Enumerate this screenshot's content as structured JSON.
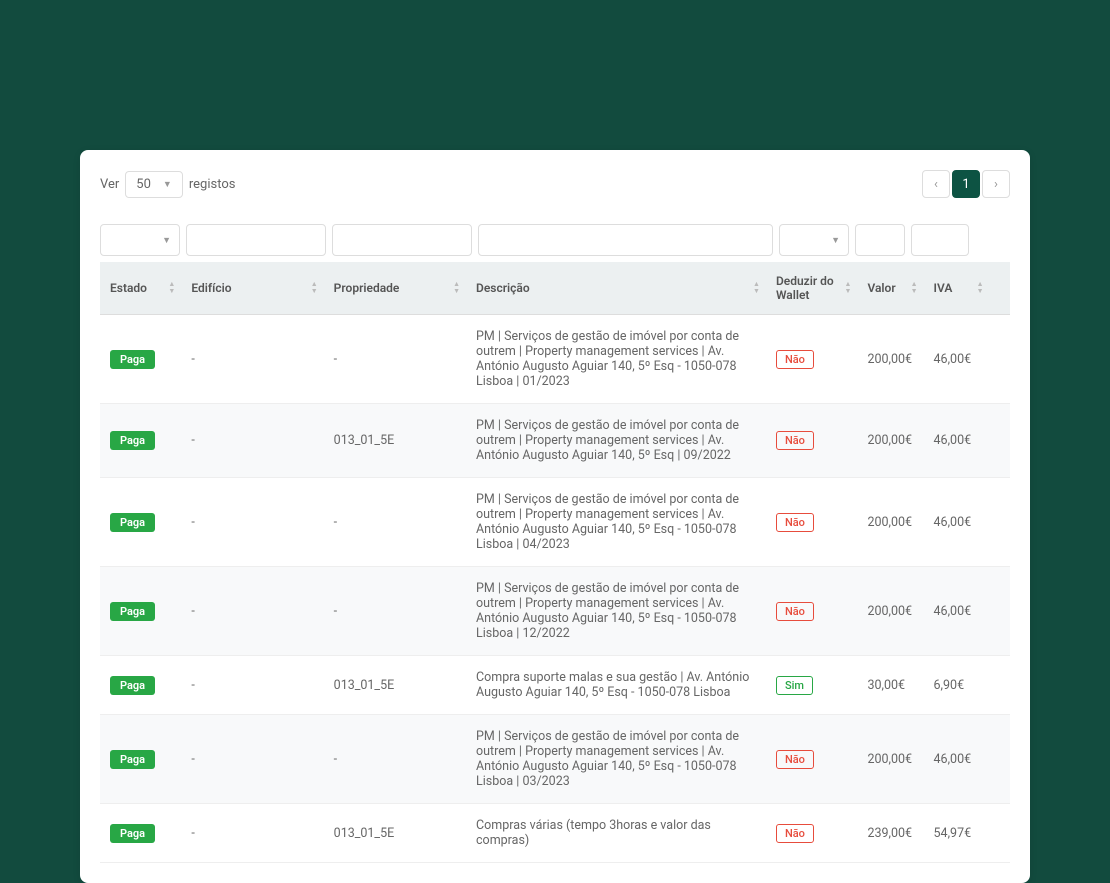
{
  "pageSize": {
    "prefix": "Ver",
    "value": "50",
    "suffix": "registos"
  },
  "pagination": {
    "current": "1"
  },
  "columns": {
    "estado": "Estado",
    "edificio": "Edifício",
    "propriedade": "Propriedade",
    "descricao": "Descrição",
    "deduzir": "Deduzir do Wallet",
    "valor": "Valor",
    "iva": "IVA"
  },
  "badges": {
    "paga": "Paga",
    "nao": "Não",
    "sim": "Sim"
  },
  "rows": [
    {
      "estado": "Paga",
      "edificio": "-",
      "propriedade": "-",
      "descricao": "PM | Serviços de gestão de imóvel por conta de outrem | Property management services | Av. António Augusto Aguiar 140, 5º Esq - 1050-078 Lisboa | 01/2023",
      "deduzir": "Não",
      "valor": "200,00€",
      "iva": "46,00€"
    },
    {
      "estado": "Paga",
      "edificio": "-",
      "propriedade": "013_01_5E",
      "descricao": "PM | Serviços de gestão de imóvel por conta de outrem | Property management services | Av. António Augusto Aguiar 140, 5º Esq | 09/2022",
      "deduzir": "Não",
      "valor": "200,00€",
      "iva": "46,00€"
    },
    {
      "estado": "Paga",
      "edificio": "-",
      "propriedade": "-",
      "descricao": "PM | Serviços de gestão de imóvel por conta de outrem | Property management services | Av. António Augusto Aguiar 140, 5º Esq - 1050-078 Lisboa | 04/2023",
      "deduzir": "Não",
      "valor": "200,00€",
      "iva": "46,00€"
    },
    {
      "estado": "Paga",
      "edificio": "-",
      "propriedade": "-",
      "descricao": "PM | Serviços de gestão de imóvel por conta de outrem | Property management services | Av. António Augusto Aguiar 140, 5º Esq - 1050-078 Lisboa | 12/2022",
      "deduzir": "Não",
      "valor": "200,00€",
      "iva": "46,00€"
    },
    {
      "estado": "Paga",
      "edificio": "-",
      "propriedade": "013_01_5E",
      "descricao": "Compra suporte malas e sua gestão | Av. António Augusto Aguiar 140, 5º Esq - 1050-078 Lisboa",
      "deduzir": "Sim",
      "valor": "30,00€",
      "iva": "6,90€"
    },
    {
      "estado": "Paga",
      "edificio": "-",
      "propriedade": "-",
      "descricao": "PM | Serviços de gestão de imóvel por conta de outrem | Property management services | Av. António Augusto Aguiar 140, 5º Esq - 1050-078 Lisboa | 03/2023",
      "deduzir": "Não",
      "valor": "200,00€",
      "iva": "46,00€"
    },
    {
      "estado": "Paga",
      "edificio": "-",
      "propriedade": "013_01_5E",
      "descricao": "Compras várias (tempo 3horas e valor das compras)",
      "deduzir": "Não",
      "valor": "239,00€",
      "iva": "54,97€"
    }
  ]
}
